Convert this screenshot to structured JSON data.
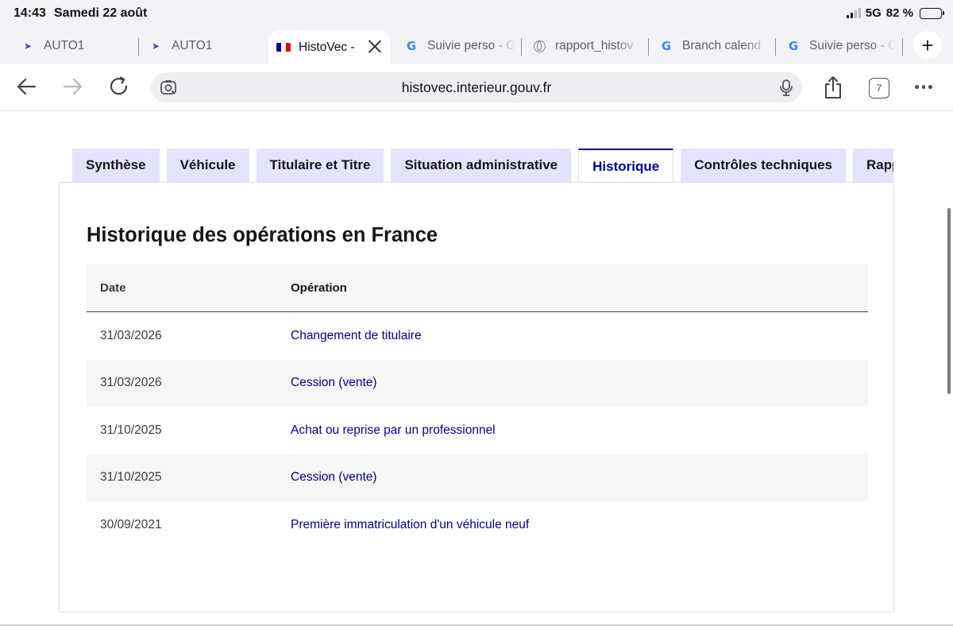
{
  "status": {
    "time": "14:43",
    "date": "Samedi 22 août",
    "network": "5G",
    "battery_percent": "82 %",
    "battery_level": 0.82
  },
  "browser_tabs": [
    {
      "title": "AUTO1",
      "favicon": "auto1-icon",
      "active": false
    },
    {
      "title": "AUTO1",
      "favicon": "auto1-icon",
      "active": false
    },
    {
      "title": "HistoVec -",
      "favicon": "french-flag-icon",
      "active": true
    },
    {
      "title": "Suivie perso - G",
      "favicon": "google-icon",
      "active": false
    },
    {
      "title": "rapport_histov",
      "favicon": "globe-icon",
      "active": false
    },
    {
      "title": "Branch calend",
      "favicon": "google-icon",
      "active": false
    },
    {
      "title": "Suivie perso - G",
      "favicon": "google-icon",
      "active": false
    }
  ],
  "new_tab_label": "+",
  "toolbar": {
    "url": "histovec.interieur.gouv.fr",
    "tab_count": "7"
  },
  "nav_tabs": [
    {
      "label": "Synthèse",
      "active": false
    },
    {
      "label": "Véhicule",
      "active": false
    },
    {
      "label": "Titulaire et Titre",
      "active": false
    },
    {
      "label": "Situation administrative",
      "active": false
    },
    {
      "label": "Historique",
      "active": true
    },
    {
      "label": "Contrôles techniques",
      "active": false
    },
    {
      "label": "Rapport",
      "active": false
    }
  ],
  "panel": {
    "title": "Historique des opérations en France",
    "columns": {
      "date": "Date",
      "operation": "Opération"
    },
    "rows": [
      {
        "date": "31/03/2026",
        "operation": "Changement de titulaire"
      },
      {
        "date": "31/03/2026",
        "operation": "Cession (vente)"
      },
      {
        "date": "31/10/2025",
        "operation": "Achat ou reprise par un professionnel"
      },
      {
        "date": "31/10/2025",
        "operation": "Cession (vente)"
      },
      {
        "date": "30/09/2021",
        "operation": "Première immatriculation d'un véhicule neuf"
      }
    ]
  },
  "colors": {
    "accent_blue": "#000091",
    "tab_background": "#e3e3fd",
    "row_stripe": "#f6f6f6"
  }
}
